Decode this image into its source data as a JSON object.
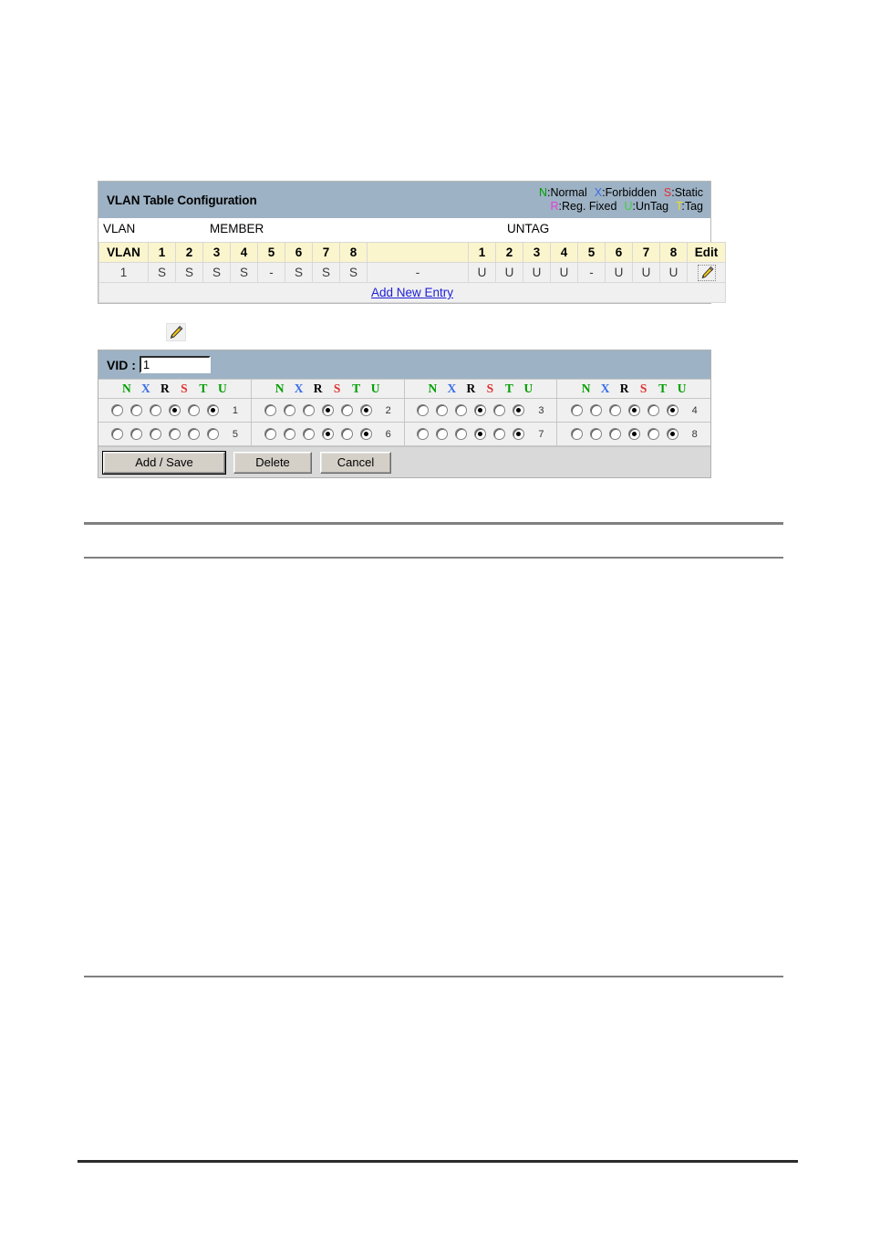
{
  "vlan_table": {
    "title": "VLAN Table Configuration",
    "legend": {
      "row1": [
        {
          "key": "N",
          "label": ":Normal",
          "color": "#00a000"
        },
        {
          "key": "X",
          "label": ":Forbidden",
          "color": "#3a6ee8"
        },
        {
          "key": "S",
          "label": ":Static",
          "color": "#e03030"
        }
      ],
      "row2": [
        {
          "key": "R",
          "label": ":Reg. Fixed",
          "color": "#e83fd4"
        },
        {
          "key": "U",
          "label": ":UnTag",
          "color": "#40d040"
        },
        {
          "key": "T",
          "label": ":Tag",
          "color": "#e8e020"
        }
      ]
    },
    "group_labels": {
      "vlan": "VLAN",
      "member": "MEMBER",
      "untag": "UNTAG"
    },
    "headers": {
      "vlan": "VLAN",
      "member_ports": [
        "1",
        "2",
        "3",
        "4",
        "5",
        "6",
        "7",
        "8"
      ],
      "gap": "",
      "untag_ports": [
        "1",
        "2",
        "3",
        "4",
        "5",
        "6",
        "7",
        "8"
      ],
      "edit": "Edit"
    },
    "rows": [
      {
        "vlan": "1",
        "member": [
          "S",
          "S",
          "S",
          "S",
          "-",
          "S",
          "S",
          "S"
        ],
        "gap": "-",
        "untag": [
          "U",
          "U",
          "U",
          "U",
          "-",
          "U",
          "U",
          "U"
        ],
        "edit_icon": "pencil-icon"
      }
    ],
    "add_new_entry": "Add New Entry"
  },
  "standalone_pencil": {
    "icon": "pencil-icon"
  },
  "vid_panel": {
    "vid_label": "VID :",
    "vid_value": "1",
    "vid_placeholder": "",
    "mode_headers": [
      "N",
      "X",
      "R",
      "S",
      "T",
      "U"
    ],
    "mode_header_colors": [
      "#00a000",
      "#3a6ee8",
      "#000000",
      "#e03030",
      "#00a000",
      "#00a000"
    ],
    "ports": [
      {
        "num": "1",
        "selected": [
          false,
          false,
          false,
          true,
          false,
          true
        ]
      },
      {
        "num": "2",
        "selected": [
          false,
          false,
          false,
          true,
          false,
          true
        ]
      },
      {
        "num": "3",
        "selected": [
          false,
          false,
          false,
          true,
          false,
          true
        ]
      },
      {
        "num": "4",
        "selected": [
          false,
          false,
          false,
          true,
          false,
          true
        ]
      },
      {
        "num": "5",
        "selected": [
          false,
          false,
          false,
          false,
          false,
          false
        ]
      },
      {
        "num": "6",
        "selected": [
          false,
          false,
          false,
          true,
          false,
          true
        ]
      },
      {
        "num": "7",
        "selected": [
          false,
          false,
          false,
          true,
          false,
          true
        ]
      },
      {
        "num": "8",
        "selected": [
          false,
          false,
          false,
          true,
          false,
          true
        ]
      }
    ],
    "buttons": {
      "add_save": "Add / Save",
      "delete": "Delete",
      "cancel": "Cancel"
    }
  }
}
